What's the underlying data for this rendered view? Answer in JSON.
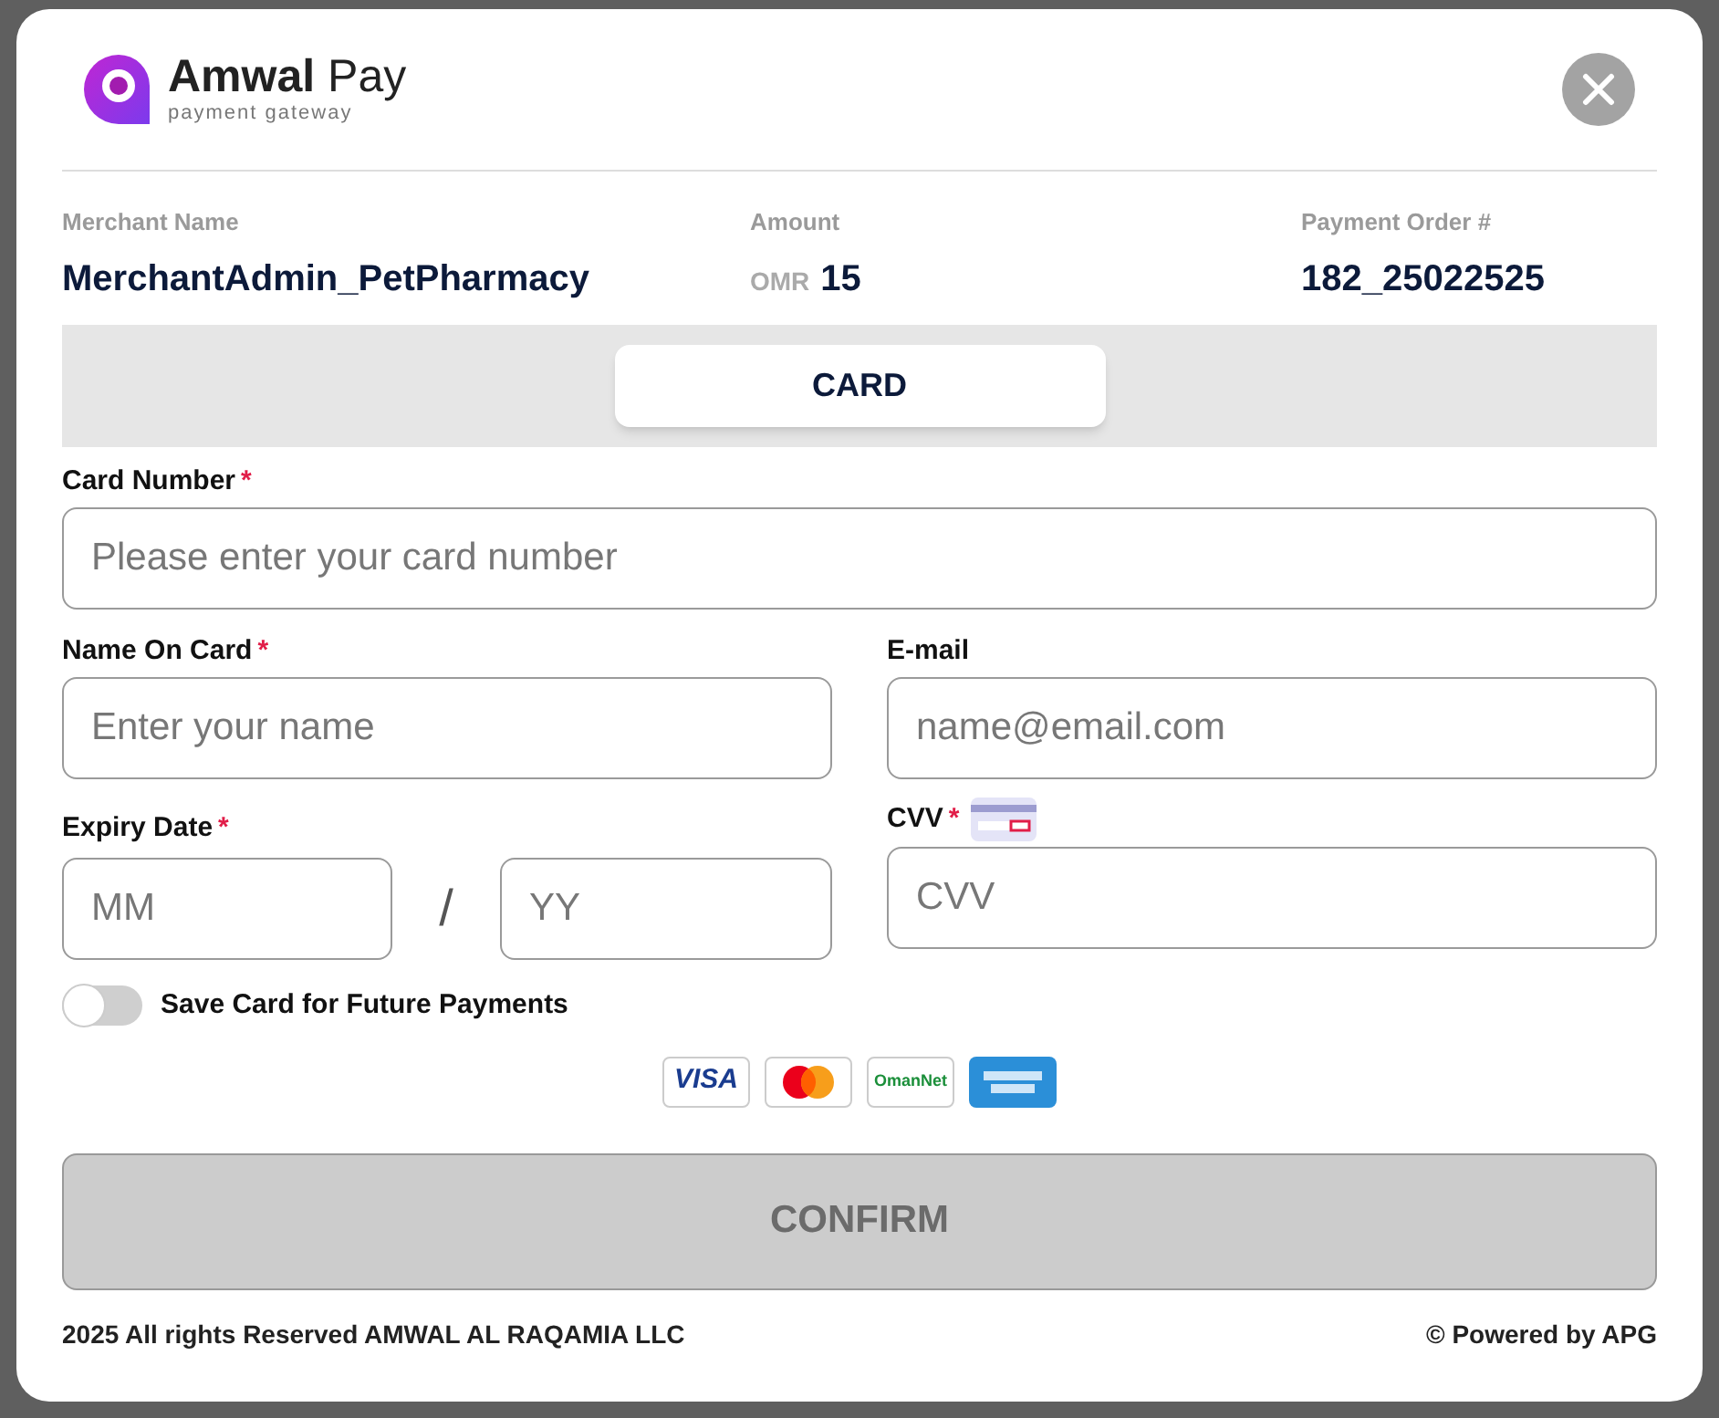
{
  "logo": {
    "name": "**Amwal** Pay",
    "tagline": "payment gateway"
  },
  "summary": [
    {
      "label": "Merchant Name",
      "value": "MerchantAdmin_PetPharmacy"
    },
    {
      "label": "Amount",
      "currency": "OMR",
      "value": "15"
    },
    {
      "label": "Payment Order #",
      "value": "182_25022525"
    }
  ],
  "tabs": [
    {
      "label": "CARD",
      "selected": true
    }
  ],
  "card_number": {
    "label": "Card Number",
    "mark": "*",
    "placeholder": "Please enter your card number"
  },
  "name_on_card": {
    "label": "Name On Card",
    "mark": "*",
    "placeholder": "Enter your name"
  },
  "email": {
    "label": "E-mail",
    "placeholder": "name@email.com"
  },
  "expiry": {
    "label": "Expiry Date",
    "mark": "*",
    "month_placeholder": "MM",
    "separator": "/",
    "year_placeholder": "YY"
  },
  "cvv": {
    "label": "CVV",
    "mark": "*",
    "placeholder": "CVV"
  },
  "save_card": {
    "label": "Save Card for Future Payments",
    "on": false
  },
  "payment_methods": [
    {
      "kind": "visa",
      "text": "VISA"
    },
    {
      "kind": "mastercard"
    },
    {
      "kind": "omannet",
      "text": "OmanNet"
    },
    {
      "kind": "amex"
    }
  ],
  "confirm": {
    "label": "CONFIRM",
    "disabled": true
  },
  "footer": {
    "left": "2025 All rights Reserved AMWAL AL RAQAMIA LLC",
    "right": "© Powered by APG"
  }
}
